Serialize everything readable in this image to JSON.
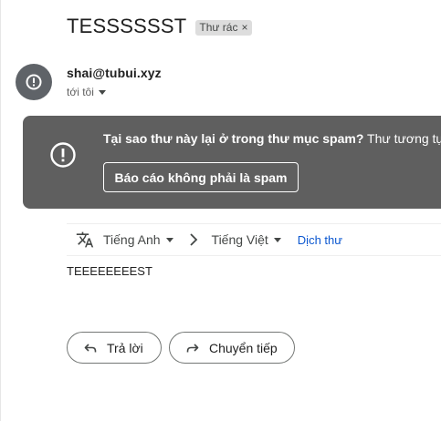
{
  "email": {
    "subject": "TESSSSSST",
    "label_chip": {
      "text": "Thư rác",
      "close_glyph": "×"
    },
    "sender": {
      "email": "shai@tubui.xyz",
      "recipient_text": "tới tôi",
      "avatar_icon": "alert-circle-icon"
    },
    "spam_banner": {
      "icon": "alert-circle-icon",
      "question": "Tại sao thư này lại ở trong thư mục spam?",
      "explanation": " Thư tương tự",
      "report_button_label": "Báo cáo không phải là spam",
      "background_color": "#5f5f5f"
    },
    "translate_bar": {
      "icon": "translate-icon",
      "source_language": "Tiếng Anh",
      "target_language": "Tiếng Việt",
      "translate_link": "Dịch thư",
      "link_color": "#0b57d0"
    },
    "body_text": "TEEEEEEEEST",
    "actions": {
      "reply_label": "Trả lời",
      "reply_icon": "reply-icon",
      "forward_label": "Chuyển tiếp",
      "forward_icon": "forward-icon"
    }
  }
}
